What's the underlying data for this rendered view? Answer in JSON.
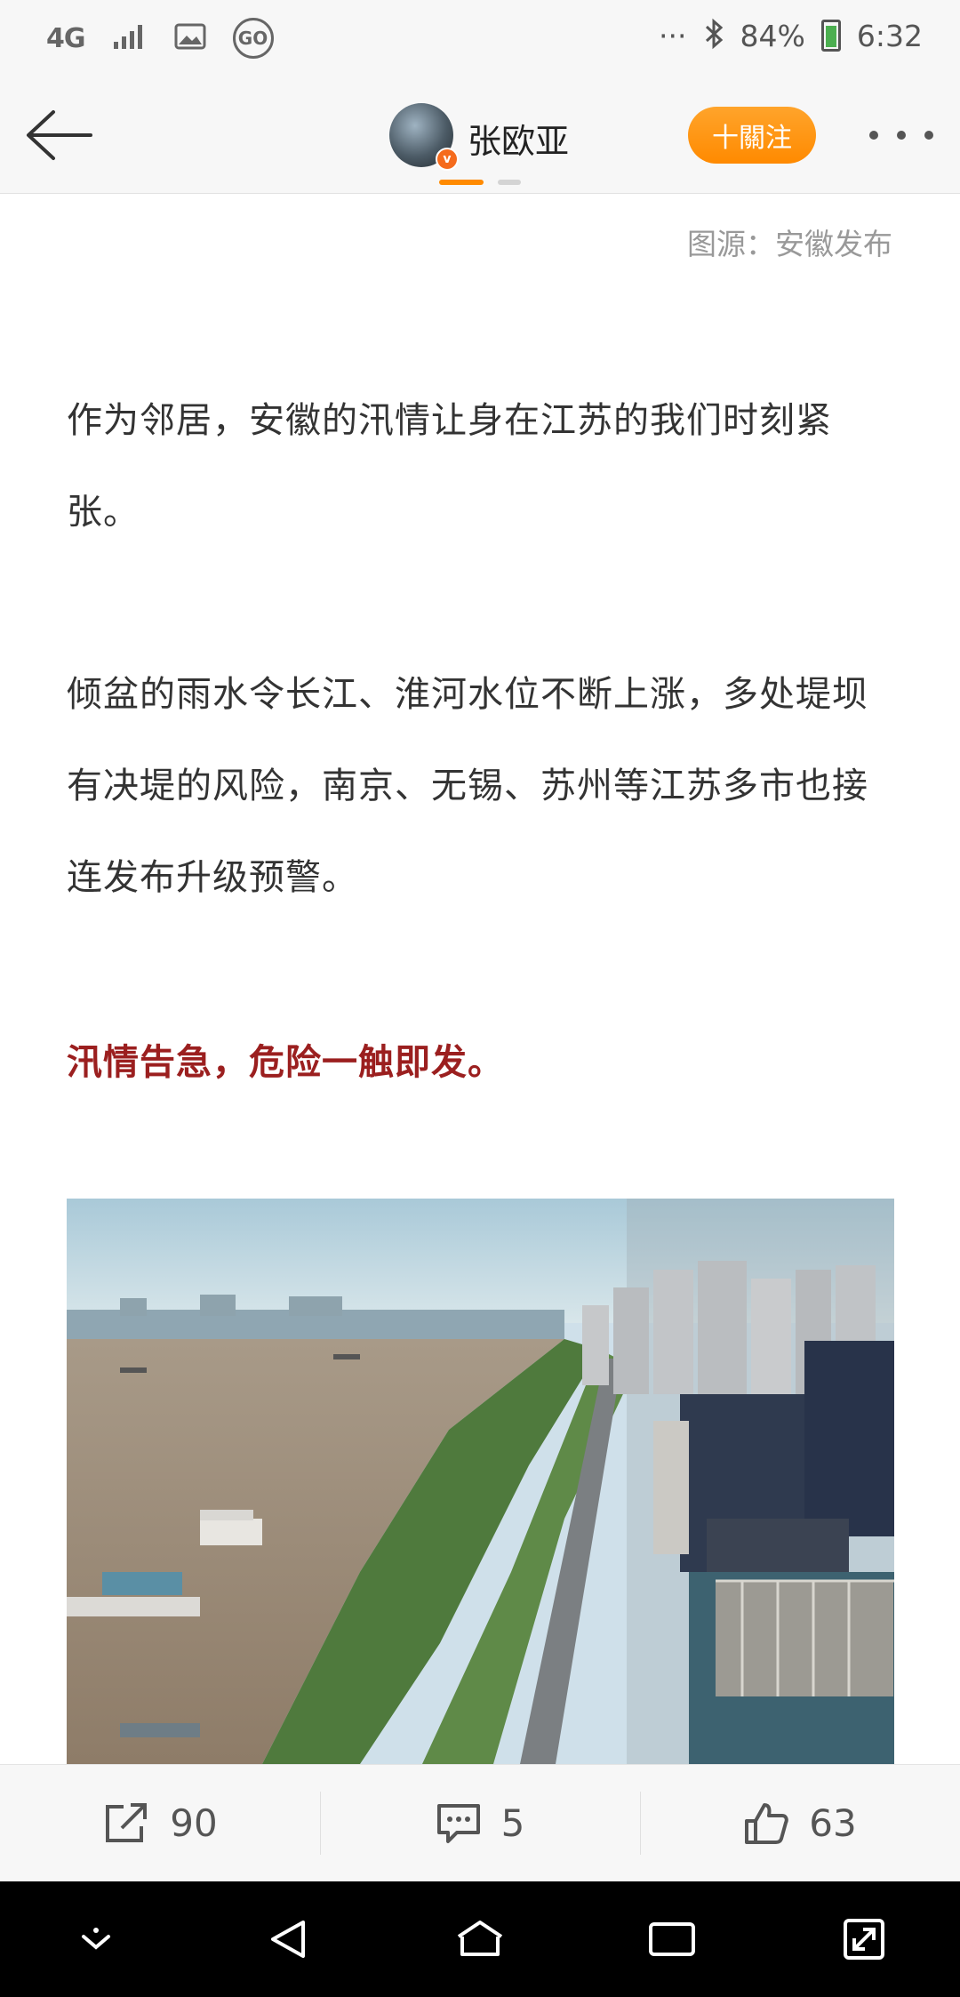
{
  "status_bar": {
    "network": "4G",
    "battery_percent": "84%",
    "time": "6:32",
    "more": "···"
  },
  "header": {
    "username": "张欧亚",
    "follow_label": "十關注",
    "verified_badge": "v"
  },
  "article": {
    "source": "图源：安徽发布",
    "paragraph_1": "作为邻居，安徽的汛情让身在江苏的我们时刻紧张。",
    "paragraph_2": "倾盆的雨水令长江、淮河水位不断上涨，多处堤坝有决堤的风险，南京、无锡、苏州等江苏多市也接连发布升级预警。",
    "highlight": "汛情告急，危险一触即发。",
    "highlight_color": "#9b1f1f"
  },
  "actions": {
    "share_count": "90",
    "comment_count": "5",
    "like_count": "63"
  },
  "colors": {
    "accent": "#ff8a00",
    "navbar": "#000000"
  }
}
